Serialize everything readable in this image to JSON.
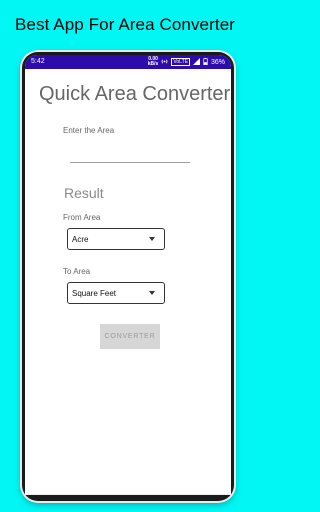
{
  "promo": {
    "headline": "Best App For Area Converter"
  },
  "statusbar": {
    "time": "5:42",
    "speed_value": "0.00",
    "speed_unit": "kB/s",
    "network": "VoLTE",
    "battery": "36%"
  },
  "app": {
    "title": "Quick Area Converter",
    "input": {
      "label": "Enter the Area",
      "value": ""
    },
    "result_label": "Result",
    "from": {
      "label": "From Area",
      "selected": "Acre"
    },
    "to": {
      "label": "To Area",
      "selected": "Square Feet"
    },
    "convert_label": "CONVERTER"
  },
  "colors": {
    "background": "#00f7f4",
    "statusbar": "#2d0cad",
    "button": "#d6d6d6"
  }
}
